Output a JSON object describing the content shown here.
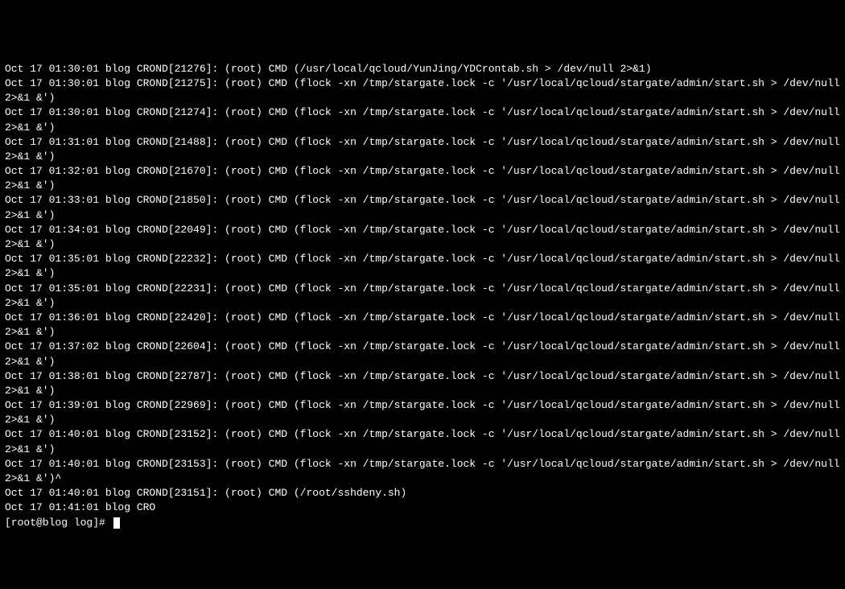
{
  "lines": [
    "Oct 17 01:30:01 blog CROND[21276]: (root) CMD (/usr/local/qcloud/YunJing/YDCrontab.sh > /dev/null 2>&1)",
    "Oct 17 01:30:01 blog CROND[21275]: (root) CMD (flock -xn /tmp/stargate.lock -c '/usr/local/qcloud/stargate/admin/start.sh > /dev/null 2>&1 &')",
    "Oct 17 01:30:01 blog CROND[21274]: (root) CMD (flock -xn /tmp/stargate.lock -c '/usr/local/qcloud/stargate/admin/start.sh > /dev/null 2>&1 &')",
    "Oct 17 01:31:01 blog CROND[21488]: (root) CMD (flock -xn /tmp/stargate.lock -c '/usr/local/qcloud/stargate/admin/start.sh > /dev/null 2>&1 &')",
    "Oct 17 01:32:01 blog CROND[21670]: (root) CMD (flock -xn /tmp/stargate.lock -c '/usr/local/qcloud/stargate/admin/start.sh > /dev/null 2>&1 &')",
    "Oct 17 01:33:01 blog CROND[21850]: (root) CMD (flock -xn /tmp/stargate.lock -c '/usr/local/qcloud/stargate/admin/start.sh > /dev/null 2>&1 &')",
    "Oct 17 01:34:01 blog CROND[22049]: (root) CMD (flock -xn /tmp/stargate.lock -c '/usr/local/qcloud/stargate/admin/start.sh > /dev/null 2>&1 &')",
    "Oct 17 01:35:01 blog CROND[22232]: (root) CMD (flock -xn /tmp/stargate.lock -c '/usr/local/qcloud/stargate/admin/start.sh > /dev/null 2>&1 &')",
    "Oct 17 01:35:01 blog CROND[22231]: (root) CMD (flock -xn /tmp/stargate.lock -c '/usr/local/qcloud/stargate/admin/start.sh > /dev/null 2>&1 &')",
    "Oct 17 01:36:01 blog CROND[22420]: (root) CMD (flock -xn /tmp/stargate.lock -c '/usr/local/qcloud/stargate/admin/start.sh > /dev/null 2>&1 &')",
    "Oct 17 01:37:02 blog CROND[22604]: (root) CMD (flock -xn /tmp/stargate.lock -c '/usr/local/qcloud/stargate/admin/start.sh > /dev/null 2>&1 &')",
    "Oct 17 01:38:01 blog CROND[22787]: (root) CMD (flock -xn /tmp/stargate.lock -c '/usr/local/qcloud/stargate/admin/start.sh > /dev/null 2>&1 &')",
    "Oct 17 01:39:01 blog CROND[22969]: (root) CMD (flock -xn /tmp/stargate.lock -c '/usr/local/qcloud/stargate/admin/start.sh > /dev/null 2>&1 &')",
    "Oct 17 01:40:01 blog CROND[23152]: (root) CMD (flock -xn /tmp/stargate.lock -c '/usr/local/qcloud/stargate/admin/start.sh > /dev/null 2>&1 &')",
    "Oct 17 01:40:01 blog CROND[23153]: (root) CMD (flock -xn /tmp/stargate.lock -c '/usr/local/qcloud/stargate/admin/start.sh > /dev/null 2>&1 &')^",
    "Oct 17 01:40:01 blog CROND[23151]: (root) CMD (/root/sshdeny.sh)",
    "Oct 17 01:41:01 blog CRO"
  ],
  "prompt": "[root@blog log]# "
}
